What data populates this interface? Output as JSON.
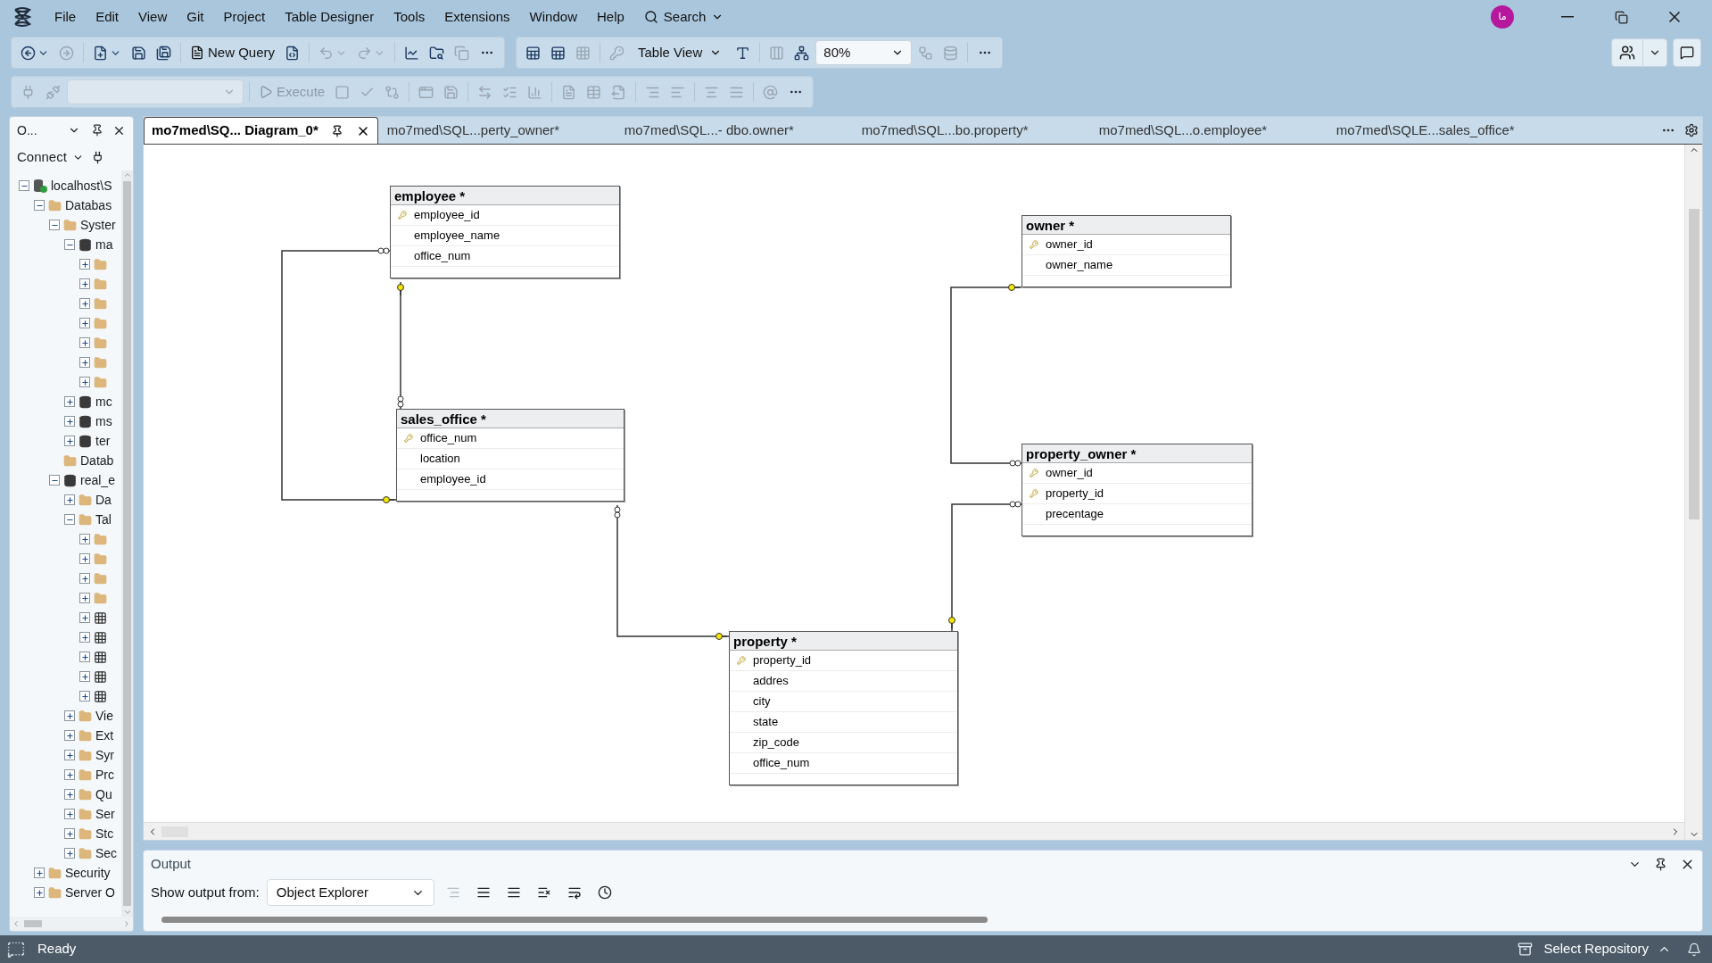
{
  "menu": {
    "items": [
      "File",
      "Edit",
      "View",
      "Git",
      "Project",
      "Table Designer",
      "Tools",
      "Extensions",
      "Window",
      "Help"
    ],
    "search": "Search"
  },
  "account": {
    "initials": "ما"
  },
  "toolbar_main": [
    {
      "kind": "icon",
      "disabled": false,
      "caret": true
    },
    {
      "kind": "icon",
      "disabled": true,
      "caret": false
    },
    {
      "kind": "separator"
    },
    {
      "kind": "icon",
      "disabled": false,
      "caret": true
    },
    {
      "kind": "icon",
      "disabled": false,
      "caret": false
    },
    {
      "kind": "icon",
      "disabled": false,
      "caret": false
    },
    {
      "kind": "separator"
    },
    {
      "kind": "button",
      "label": "New Query",
      "disabled": false
    },
    {
      "kind": "icon",
      "disabled": false,
      "caret": false
    },
    {
      "kind": "separator"
    },
    {
      "kind": "icon",
      "disabled": true,
      "caret": true
    },
    {
      "kind": "icon",
      "disabled": true,
      "caret": true
    },
    {
      "kind": "separator"
    },
    {
      "kind": "icon",
      "disabled": false,
      "caret": false
    },
    {
      "kind": "icon",
      "disabled": false,
      "caret": false
    },
    {
      "kind": "icon",
      "disabled": true,
      "caret": false
    },
    {
      "kind": "more"
    }
  ],
  "toolbar_designer": [
    {
      "kind": "icon",
      "disabled": false,
      "caret": false
    },
    {
      "kind": "icon",
      "disabled": false,
      "caret": false
    },
    {
      "kind": "icon",
      "disabled": true,
      "caret": false
    },
    {
      "kind": "separator"
    },
    {
      "kind": "icon",
      "disabled": true,
      "caret": false
    },
    {
      "kind": "dropdown",
      "label": "Table View",
      "disabled": false
    },
    {
      "kind": "icon",
      "disabled": false,
      "caret": false
    },
    {
      "kind": "separator"
    },
    {
      "kind": "icon",
      "disabled": true,
      "caret": false
    },
    {
      "kind": "icon",
      "disabled": false,
      "caret": false
    },
    {
      "kind": "select",
      "label": "80%",
      "disabled": false
    },
    {
      "kind": "icon",
      "disabled": true,
      "caret": false
    },
    {
      "kind": "icon",
      "disabled": true,
      "caret": false
    },
    {
      "kind": "separator"
    },
    {
      "kind": "more"
    }
  ],
  "toolbar_query": [
    {
      "kind": "icon",
      "disabled": true,
      "caret": false
    },
    {
      "kind": "icon",
      "disabled": true,
      "caret": false
    },
    {
      "kind": "select",
      "disabled": true
    },
    {
      "kind": "separator"
    },
    {
      "kind": "button",
      "label": "Execute",
      "disabled": true
    },
    {
      "kind": "icon",
      "disabled": true,
      "caret": false
    },
    {
      "kind": "icon",
      "disabled": true,
      "caret": false
    },
    {
      "kind": "icon",
      "disabled": true,
      "caret": false
    },
    {
      "kind": "separator"
    },
    {
      "kind": "icon",
      "disabled": true,
      "caret": false
    },
    {
      "kind": "icon",
      "disabled": true,
      "caret": false
    },
    {
      "kind": "separator"
    },
    {
      "kind": "icon",
      "disabled": true,
      "caret": false
    },
    {
      "kind": "icon",
      "disabled": true,
      "caret": false
    },
    {
      "kind": "icon",
      "disabled": true,
      "caret": false
    },
    {
      "kind": "separator"
    },
    {
      "kind": "icon",
      "disabled": true,
      "caret": false
    },
    {
      "kind": "icon",
      "disabled": true,
      "caret": false
    },
    {
      "kind": "icon",
      "disabled": true,
      "caret": false
    },
    {
      "kind": "separator"
    },
    {
      "kind": "icon",
      "disabled": true,
      "caret": false
    },
    {
      "kind": "icon",
      "disabled": true,
      "caret": false
    },
    {
      "kind": "separator"
    },
    {
      "kind": "icon",
      "disabled": true,
      "caret": false
    },
    {
      "kind": "icon",
      "disabled": true,
      "caret": false
    },
    {
      "kind": "separator"
    },
    {
      "kind": "icon",
      "disabled": true,
      "caret": false
    },
    {
      "kind": "more"
    }
  ],
  "object_explorer": {
    "title": "O...",
    "connect": "Connect",
    "tree": [
      {
        "kind": "server",
        "label": "localhost\\S",
        "expanded": true,
        "children": [
          {
            "kind": "folder",
            "label": "Databas",
            "expanded": true,
            "children": [
              {
                "kind": "folder",
                "label": "Syster",
                "expanded": true,
                "children": [
                  {
                    "kind": "database",
                    "label": "ma",
                    "expanded": true,
                    "children": [
                      {
                        "kind": "folder",
                        "expanded": false
                      },
                      {
                        "kind": "folder",
                        "expanded": false
                      },
                      {
                        "kind": "folder",
                        "expanded": false
                      },
                      {
                        "kind": "folder",
                        "expanded": false
                      },
                      {
                        "kind": "folder",
                        "expanded": false
                      },
                      {
                        "kind": "folder",
                        "expanded": false
                      },
                      {
                        "kind": "folder",
                        "expanded": false
                      }
                    ]
                  },
                  {
                    "kind": "database",
                    "label": "mc",
                    "expanded": false
                  },
                  {
                    "kind": "database",
                    "label": "ms",
                    "expanded": false
                  },
                  {
                    "kind": "database",
                    "label": "ter",
                    "expanded": false
                  }
                ]
              },
              {
                "kind": "folder",
                "label": "Datab"
              },
              {
                "kind": "database",
                "label": "real_e",
                "expanded": true,
                "children": [
                  {
                    "kind": "folder",
                    "label": "Da",
                    "expanded": false
                  },
                  {
                    "kind": "folder",
                    "label": "Tal",
                    "expanded": true,
                    "children": [
                      {
                        "kind": "folder",
                        "expanded": false
                      },
                      {
                        "kind": "folder",
                        "expanded": false
                      },
                      {
                        "kind": "folder",
                        "expanded": false
                      },
                      {
                        "kind": "folder",
                        "expanded": false
                      },
                      {
                        "kind": "table",
                        "expanded": false
                      },
                      {
                        "kind": "table",
                        "expanded": false
                      },
                      {
                        "kind": "table",
                        "expanded": false
                      },
                      {
                        "kind": "table",
                        "expanded": false
                      },
                      {
                        "kind": "table",
                        "expanded": false
                      }
                    ]
                  },
                  {
                    "kind": "folder",
                    "label": "Vie",
                    "expanded": false
                  },
                  {
                    "kind": "folder",
                    "label": "Ext",
                    "expanded": false
                  },
                  {
                    "kind": "folder",
                    "label": "Syr",
                    "expanded": false
                  },
                  {
                    "kind": "folder",
                    "label": "Prc",
                    "expanded": false
                  },
                  {
                    "kind": "folder",
                    "label": "Qu",
                    "expanded": false
                  },
                  {
                    "kind": "folder",
                    "label": "Ser",
                    "expanded": false
                  },
                  {
                    "kind": "folder",
                    "label": "Stc",
                    "expanded": false
                  },
                  {
                    "kind": "folder",
                    "label": "Sec",
                    "expanded": false
                  }
                ]
              }
            ]
          },
          {
            "kind": "folder",
            "label": "Security",
            "expanded": false
          },
          {
            "kind": "folder",
            "label": "Server O",
            "expanded": false
          }
        ]
      }
    ]
  },
  "tabs": [
    {
      "label": "mo7med\\SQ... Diagram_0*",
      "selected": true
    },
    {
      "label": "mo7med\\SQL...perty_owner*",
      "selected": false
    },
    {
      "label": "mo7med\\SQL...- dbo.owner*",
      "selected": false
    },
    {
      "label": "mo7med\\SQL...bo.property*",
      "selected": false
    },
    {
      "label": "mo7med\\SQL...o.employee*",
      "selected": false
    },
    {
      "label": "mo7med\\SQLE...sales_office*",
      "selected": false
    }
  ],
  "diagram": {
    "tables": [
      {
        "name": "employee *",
        "columns": [
          {
            "name": "employee_id",
            "primary_key": true
          },
          {
            "name": "employee_name",
            "primary_key": false
          },
          {
            "name": "office_num",
            "primary_key": false
          }
        ]
      },
      {
        "name": "owner *",
        "columns": [
          {
            "name": "owner_id",
            "primary_key": true
          },
          {
            "name": "owner_name",
            "primary_key": false
          }
        ]
      },
      {
        "name": "sales_office *",
        "columns": [
          {
            "name": "office_num",
            "primary_key": true
          },
          {
            "name": "location",
            "primary_key": false
          },
          {
            "name": "employee_id",
            "primary_key": false
          }
        ]
      },
      {
        "name": "property_owner *",
        "columns": [
          {
            "name": "owner_id",
            "primary_key": true
          },
          {
            "name": "property_id",
            "primary_key": true
          },
          {
            "name": "precentage",
            "primary_key": false
          }
        ]
      },
      {
        "name": "property *",
        "columns": [
          {
            "name": "property_id",
            "primary_key": true
          },
          {
            "name": "addres",
            "primary_key": false
          },
          {
            "name": "city",
            "primary_key": false
          },
          {
            "name": "state",
            "primary_key": false
          },
          {
            "name": "zip_code",
            "primary_key": false
          },
          {
            "name": "office_num",
            "primary_key": false
          }
        ]
      }
    ]
  },
  "output": {
    "title": "Output",
    "source_label": "Show output from:",
    "source": "Object Explorer",
    "tools": [
      {
        "disabled": true
      },
      {
        "disabled": false
      },
      {
        "disabled": false
      },
      {
        "disabled": false
      },
      {
        "disabled": false
      },
      {
        "disabled": false
      }
    ]
  },
  "status_bar": {
    "text": "Ready",
    "repository": "Select Repository"
  }
}
